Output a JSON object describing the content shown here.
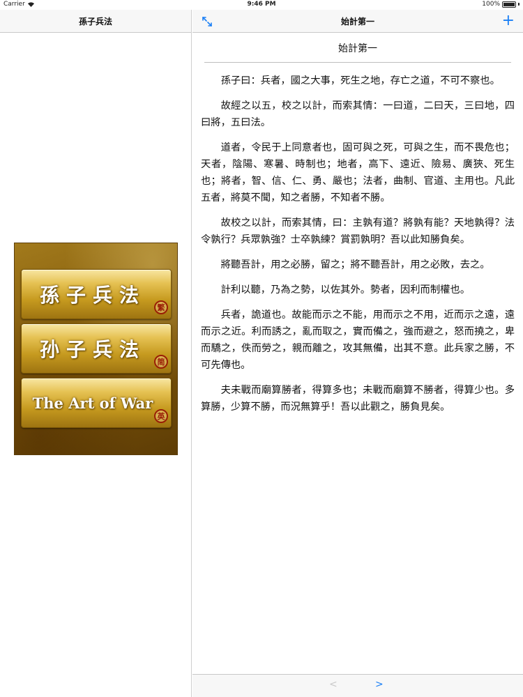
{
  "status_bar": {
    "carrier": "Carrier",
    "time": "9:46 PM",
    "battery": "100%",
    "battery_level": 1.0
  },
  "master": {
    "nav_title": "孫子兵法",
    "cover_buttons": [
      {
        "title": "孫子兵法",
        "seal": "繁"
      },
      {
        "title": "孙子兵法",
        "seal": "简"
      },
      {
        "title": "The Art of War",
        "seal": "英"
      }
    ]
  },
  "detail": {
    "nav_title": "始計第一",
    "add_label": "+",
    "doc_title": "始計第一",
    "paragraphs": [
      "孫子曰：兵者，國之大事，死生之地，存亡之道，不可不察也。",
      "故經之以五，校之以計，而索其情：一曰道，二曰天，三曰地，四曰將，五曰法。",
      "道者，令民于上同意者也，固可與之死，可與之生，而不畏危也；天者，陰陽、寒暑、時制也；地者，高下、遠近、險易、廣狹、死生也；將者，智、信、仁、勇、嚴也；法者，曲制、官道、主用也。凡此五者，將莫不聞，知之者勝，不知者不勝。",
      "故校之以計，而索其情，曰：主孰有道？將孰有能？天地孰得？法令孰行？兵眾孰強？士卒孰練？賞罰孰明？吾以此知勝負矣。",
      "將聽吾計，用之必勝，留之；將不聽吾計，用之必敗，去之。",
      "計利以聽，乃為之勢，以佐其外。勢者，因利而制權也。",
      "兵者，詭道也。故能而示之不能，用而示之不用，近而示之遠，遠而示之近。利而誘之，亂而取之，實而備之，強而避之，怒而撓之，卑而驕之，佚而勞之，親而離之，攻其無備，出其不意。此兵家之勝，不可先傳也。",
      "夫未戰而廟算勝者，得算多也；未戰而廟算不勝者，得算少也。多算勝，少算不勝，而況無算乎！吾以此觀之，勝負見矣。"
    ]
  },
  "toolbar": {
    "prev_label": "<",
    "next_label": ">"
  },
  "colors": {
    "accent": "#1a7ff5",
    "seal_red": "#9a1e06",
    "cover_gold": "#a27a1c"
  }
}
